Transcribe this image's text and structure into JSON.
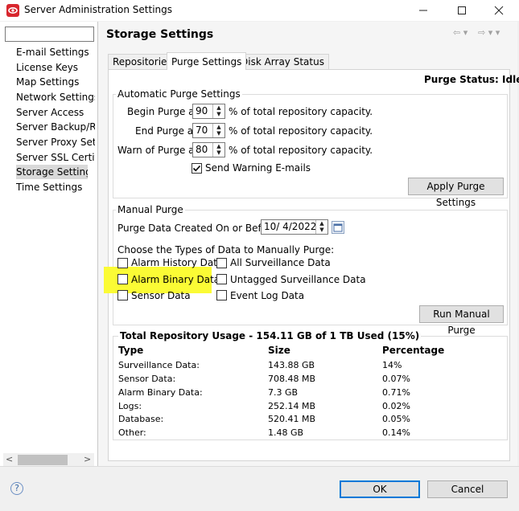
{
  "window": {
    "title": "Server Administration Settings",
    "minimize_icon": "minimize-icon",
    "maximize_icon": "maximize-icon",
    "close_icon": "close-icon"
  },
  "sidebar": {
    "filter_value": "",
    "items": [
      {
        "label": "E-mail Settings"
      },
      {
        "label": "License Keys"
      },
      {
        "label": "Map Settings"
      },
      {
        "label": "Network Settings"
      },
      {
        "label": "Server Access"
      },
      {
        "label": "Server Backup/Res"
      },
      {
        "label": "Server Proxy Settir"
      },
      {
        "label": "Server SSL Certific"
      },
      {
        "label": "Storage Settings",
        "selected": true
      },
      {
        "label": "Time Settings"
      }
    ],
    "scroll_left": "<",
    "scroll_right": ">"
  },
  "page": {
    "title": "Storage Settings",
    "nav_back": "⇦ ▾",
    "nav_forward": "⇨ ▾ ▾"
  },
  "tabs": [
    {
      "label": "Repositories"
    },
    {
      "label": "Purge Settings",
      "active": true
    },
    {
      "label": "Disk Array Status"
    }
  ],
  "purge": {
    "status": "Purge Status: Idle",
    "auto": {
      "title": "Automatic Purge Settings",
      "rows": [
        {
          "label": "Begin Purge at",
          "value": "90",
          "suffix": "% of total repository capacity."
        },
        {
          "label": "End Purge at",
          "value": "70",
          "suffix": "% of total repository capacity."
        },
        {
          "label": "Warn of Purge at",
          "value": "80",
          "suffix": "% of total repository capacity."
        }
      ],
      "send_warning": {
        "label": "Send Warning E-mails",
        "checked": true
      },
      "apply_button": "Apply Purge Settings"
    },
    "manual": {
      "title": "Manual Purge",
      "date_label": "Purge Data Created On or Before:",
      "date_value": "10/  4/2022",
      "choose_label": "Choose the Types of Data to Manually Purge:",
      "options": [
        {
          "label": "Alarm History Data",
          "checked": false
        },
        {
          "label": "All Surveillance Data",
          "checked": false
        },
        {
          "label": "Alarm Binary Data",
          "checked": false,
          "highlighted": true
        },
        {
          "label": "Untagged Surveillance Data",
          "checked": false
        },
        {
          "label": "Sensor Data",
          "checked": false
        },
        {
          "label": "Event Log Data",
          "checked": false
        }
      ],
      "run_button": "Run Manual Purge"
    }
  },
  "usage": {
    "title": "Total Repository Usage - 154.11 GB of 1 TB Used (15%)",
    "headers": [
      "Type",
      "Size",
      "Percentage"
    ],
    "rows": [
      [
        "Surveillance Data:",
        "143.88 GB",
        "14%"
      ],
      [
        "Sensor Data:",
        "708.48 MB",
        "0.07%"
      ],
      [
        "Alarm Binary Data:",
        "7.3 GB",
        "0.71%"
      ],
      [
        "Logs:",
        "252.14 MB",
        "0.02%"
      ],
      [
        "Database:",
        "520.41 MB",
        "0.05%"
      ],
      [
        "Other:",
        "1.48 GB",
        "0.14%"
      ]
    ]
  },
  "footer": {
    "help": "?",
    "ok": "OK",
    "cancel": "Cancel"
  },
  "colors": {
    "highlight": "#fbfb35",
    "accent": "#0078d7"
  }
}
